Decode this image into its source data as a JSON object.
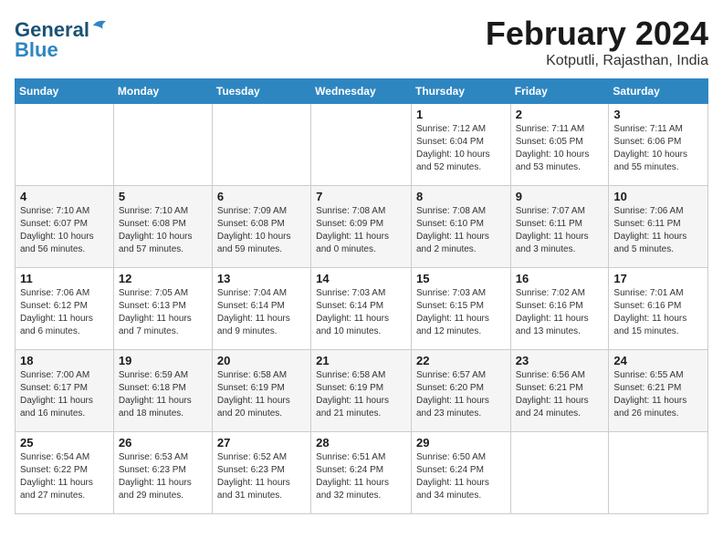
{
  "header": {
    "logo_line1": "General",
    "logo_line2": "Blue",
    "month_title": "February 2024",
    "subtitle": "Kotputli, Rajasthan, India"
  },
  "weekdays": [
    "Sunday",
    "Monday",
    "Tuesday",
    "Wednesday",
    "Thursday",
    "Friday",
    "Saturday"
  ],
  "weeks": [
    [
      {
        "day": "",
        "info": ""
      },
      {
        "day": "",
        "info": ""
      },
      {
        "day": "",
        "info": ""
      },
      {
        "day": "",
        "info": ""
      },
      {
        "day": "1",
        "info": "Sunrise: 7:12 AM\nSunset: 6:04 PM\nDaylight: 10 hours\nand 52 minutes."
      },
      {
        "day": "2",
        "info": "Sunrise: 7:11 AM\nSunset: 6:05 PM\nDaylight: 10 hours\nand 53 minutes."
      },
      {
        "day": "3",
        "info": "Sunrise: 7:11 AM\nSunset: 6:06 PM\nDaylight: 10 hours\nand 55 minutes."
      }
    ],
    [
      {
        "day": "4",
        "info": "Sunrise: 7:10 AM\nSunset: 6:07 PM\nDaylight: 10 hours\nand 56 minutes."
      },
      {
        "day": "5",
        "info": "Sunrise: 7:10 AM\nSunset: 6:08 PM\nDaylight: 10 hours\nand 57 minutes."
      },
      {
        "day": "6",
        "info": "Sunrise: 7:09 AM\nSunset: 6:08 PM\nDaylight: 10 hours\nand 59 minutes."
      },
      {
        "day": "7",
        "info": "Sunrise: 7:08 AM\nSunset: 6:09 PM\nDaylight: 11 hours\nand 0 minutes."
      },
      {
        "day": "8",
        "info": "Sunrise: 7:08 AM\nSunset: 6:10 PM\nDaylight: 11 hours\nand 2 minutes."
      },
      {
        "day": "9",
        "info": "Sunrise: 7:07 AM\nSunset: 6:11 PM\nDaylight: 11 hours\nand 3 minutes."
      },
      {
        "day": "10",
        "info": "Sunrise: 7:06 AM\nSunset: 6:11 PM\nDaylight: 11 hours\nand 5 minutes."
      }
    ],
    [
      {
        "day": "11",
        "info": "Sunrise: 7:06 AM\nSunset: 6:12 PM\nDaylight: 11 hours\nand 6 minutes."
      },
      {
        "day": "12",
        "info": "Sunrise: 7:05 AM\nSunset: 6:13 PM\nDaylight: 11 hours\nand 7 minutes."
      },
      {
        "day": "13",
        "info": "Sunrise: 7:04 AM\nSunset: 6:14 PM\nDaylight: 11 hours\nand 9 minutes."
      },
      {
        "day": "14",
        "info": "Sunrise: 7:03 AM\nSunset: 6:14 PM\nDaylight: 11 hours\nand 10 minutes."
      },
      {
        "day": "15",
        "info": "Sunrise: 7:03 AM\nSunset: 6:15 PM\nDaylight: 11 hours\nand 12 minutes."
      },
      {
        "day": "16",
        "info": "Sunrise: 7:02 AM\nSunset: 6:16 PM\nDaylight: 11 hours\nand 13 minutes."
      },
      {
        "day": "17",
        "info": "Sunrise: 7:01 AM\nSunset: 6:16 PM\nDaylight: 11 hours\nand 15 minutes."
      }
    ],
    [
      {
        "day": "18",
        "info": "Sunrise: 7:00 AM\nSunset: 6:17 PM\nDaylight: 11 hours\nand 16 minutes."
      },
      {
        "day": "19",
        "info": "Sunrise: 6:59 AM\nSunset: 6:18 PM\nDaylight: 11 hours\nand 18 minutes."
      },
      {
        "day": "20",
        "info": "Sunrise: 6:58 AM\nSunset: 6:19 PM\nDaylight: 11 hours\nand 20 minutes."
      },
      {
        "day": "21",
        "info": "Sunrise: 6:58 AM\nSunset: 6:19 PM\nDaylight: 11 hours\nand 21 minutes."
      },
      {
        "day": "22",
        "info": "Sunrise: 6:57 AM\nSunset: 6:20 PM\nDaylight: 11 hours\nand 23 minutes."
      },
      {
        "day": "23",
        "info": "Sunrise: 6:56 AM\nSunset: 6:21 PM\nDaylight: 11 hours\nand 24 minutes."
      },
      {
        "day": "24",
        "info": "Sunrise: 6:55 AM\nSunset: 6:21 PM\nDaylight: 11 hours\nand 26 minutes."
      }
    ],
    [
      {
        "day": "25",
        "info": "Sunrise: 6:54 AM\nSunset: 6:22 PM\nDaylight: 11 hours\nand 27 minutes."
      },
      {
        "day": "26",
        "info": "Sunrise: 6:53 AM\nSunset: 6:23 PM\nDaylight: 11 hours\nand 29 minutes."
      },
      {
        "day": "27",
        "info": "Sunrise: 6:52 AM\nSunset: 6:23 PM\nDaylight: 11 hours\nand 31 minutes."
      },
      {
        "day": "28",
        "info": "Sunrise: 6:51 AM\nSunset: 6:24 PM\nDaylight: 11 hours\nand 32 minutes."
      },
      {
        "day": "29",
        "info": "Sunrise: 6:50 AM\nSunset: 6:24 PM\nDaylight: 11 hours\nand 34 minutes."
      },
      {
        "day": "",
        "info": ""
      },
      {
        "day": "",
        "info": ""
      }
    ]
  ]
}
